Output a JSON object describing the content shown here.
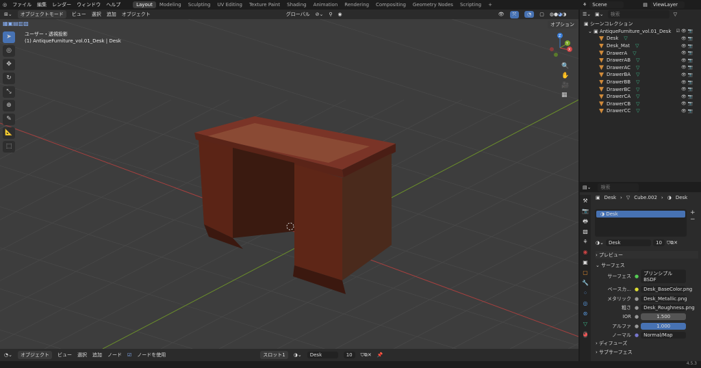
{
  "menu": {
    "items": [
      "ファイル",
      "編集",
      "レンダー",
      "ウィンドウ",
      "ヘルプ"
    ],
    "workspaces": [
      "Layout",
      "Modeling",
      "Sculpting",
      "UV Editing",
      "Texture Paint",
      "Shading",
      "Animation",
      "Rendering",
      "Compositing",
      "Geometry Nodes",
      "Scripting"
    ],
    "add": "+"
  },
  "viewport_header": {
    "mode": "オブジェクトモード",
    "menus": [
      "ビュー",
      "選択",
      "追加",
      "オブジェクト"
    ],
    "orientation": "グローバル",
    "options": "オプション"
  },
  "viewport": {
    "view_name": "ユーザー・透視投影",
    "object_info": "(1) AntiqueFurniture_vol.01_Desk | Desk",
    "gizmo": {
      "x": "X",
      "y": "Y",
      "z": "Z"
    }
  },
  "colors": {
    "accent": "#4772b3",
    "x_axis": "#a8403f",
    "y_axis": "#6b8f2a",
    "object": "#d08a3a",
    "mesh": "#3dbb8c"
  },
  "outliner": {
    "scene": "Scene",
    "view_layer": "ViewLayer",
    "search_placeholder": "検索",
    "root": "シーンコレクション",
    "collection": "AntiqueFurniture_vol.01_Desk",
    "items": [
      "Desk",
      "Desk_Mat",
      "DrawerA",
      "DrawerAB",
      "DrawerAC",
      "DrawerBA",
      "DrawerBB",
      "DrawerBC",
      "DrawerCA",
      "DrawerCB",
      "DrawerCC"
    ]
  },
  "properties": {
    "search_placeholder": "検索",
    "breadcrumb": [
      "Desk",
      "Cube.002",
      "Desk"
    ],
    "slot": "Desk",
    "material_name": "Desk",
    "users": "10",
    "panels": {
      "preview": "プレビュー",
      "surface": "サーフェス",
      "diffuse": "ディフューズ",
      "subsurface": "サブサーフェス"
    },
    "rows": [
      {
        "label": "サーフェス",
        "value": "プリンシプルBSDF"
      },
      {
        "label": "ベースカ...",
        "value": "Desk_BaseColor.png"
      },
      {
        "label": "メタリック",
        "value": "Desk_Metallic.png"
      },
      {
        "label": "粗さ",
        "value": "Desk_Roughness.png"
      },
      {
        "label": "IOR",
        "value": "1.500"
      },
      {
        "label": "アルファ",
        "value": "1.000"
      },
      {
        "label": "ノーマル",
        "value": "Normal/Map"
      }
    ]
  },
  "node_header": {
    "editor": "オブジェクト",
    "menus": [
      "ビュー",
      "選択",
      "追加",
      "ノード"
    ],
    "use_nodes": "ノードを使用",
    "slot": "スロット1",
    "material": "Desk",
    "users": "10"
  },
  "status": {
    "version": "4.5.3"
  }
}
